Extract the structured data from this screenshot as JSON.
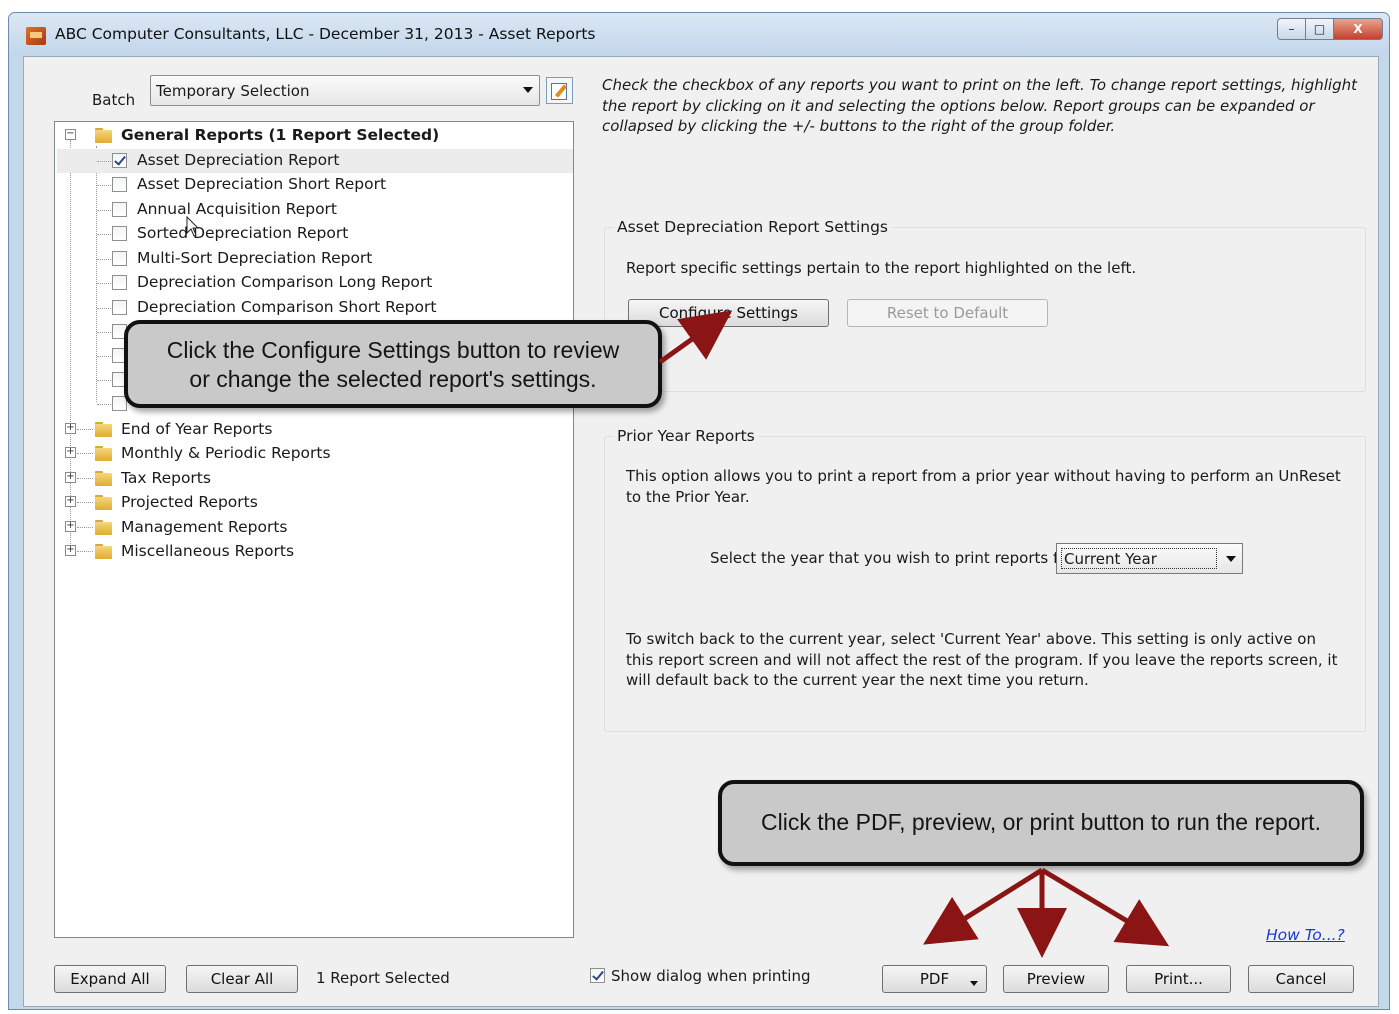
{
  "window": {
    "title": "ABC Computer Consultants, LLC - December 31, 2013 - Asset Reports",
    "minimize": "–",
    "maximize": "□",
    "close": "X"
  },
  "batch": {
    "label": "Batch",
    "value": "Temporary Selection"
  },
  "tree": {
    "general_group": "General Reports  (1 Report Selected)",
    "general_items": [
      {
        "label": "Asset Depreciation Report",
        "checked": true
      },
      {
        "label": "Asset Depreciation Short Report",
        "checked": false
      },
      {
        "label": "Annual Acquisition Report",
        "checked": false
      },
      {
        "label": "Sorted Depreciation Report",
        "checked": false
      },
      {
        "label": "Multi-Sort Depreciation Report",
        "checked": false
      },
      {
        "label": "Depreciation Comparison Long Report",
        "checked": false
      },
      {
        "label": "Depreciation Comparison Short Report",
        "checked": false
      }
    ],
    "other_groups": [
      "End of Year Reports",
      "Monthly & Periodic Reports",
      "Tax Reports",
      "Projected Reports",
      "Management Reports",
      "Miscellaneous Reports"
    ]
  },
  "instructions": "Check the checkbox of any reports you want to print on the left.  To change report settings, highlight the report by clicking on it and selecting the options below. Report groups can be expanded or collapsed by clicking the +/- buttons to the right of the group folder.",
  "settings_group": {
    "title": "Asset Depreciation Report Settings",
    "text": "Report specific settings pertain to the report highlighted on the left.",
    "configure": "Configure Settings",
    "reset": "Reset to Default"
  },
  "prior_year": {
    "title": "Prior Year Reports",
    "text": "This option allows you to print a report from a prior year without having to perform an UnReset to the Prior Year.",
    "select_label": "Select the year that you wish to print reports for",
    "select_value": "Current Year",
    "note": "To switch back to the current year, select 'Current Year' above.  This setting is only active on this report screen and will not affect the rest of the program.  If you leave the reports screen, it will default back to the current year the next time you return."
  },
  "bottom": {
    "expand_all": "Expand All",
    "clear_all": "Clear All",
    "status": "1 Report Selected",
    "show_dialog": "Show dialog when printing",
    "how_to": "How To...?",
    "pdf": "PDF",
    "preview": "Preview",
    "print": "Print...",
    "cancel": "Cancel"
  },
  "callouts": {
    "configure": "Click the Configure Settings button to review\nor change the selected report's settings.",
    "run": "Click the PDF, preview, or print button to run the report."
  },
  "colors": {
    "arrow": "#8b1414",
    "link": "#1a3ad6",
    "callout_bg": "#c9c9c9"
  }
}
